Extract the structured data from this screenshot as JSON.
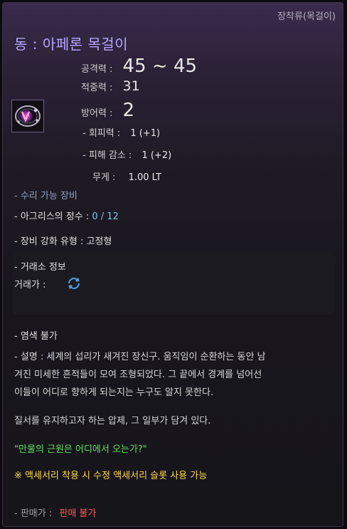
{
  "item": {
    "category": "장착류(목걸이)",
    "name": "동 : 아페론 목걸이",
    "icon": "necklace-icon"
  },
  "stats": {
    "attack_label": "공격력 :",
    "attack_value": "45 ~ 45",
    "accuracy_label": "적중력 :",
    "accuracy_value": "31",
    "defense_label": "방어력 :",
    "defense_value": "2",
    "evasion_label": "- 회피력 :",
    "evasion_value": "1 (+1)",
    "dmg_reduction_label": "- 피해 감소 :",
    "dmg_reduction_value": "1 (+2)",
    "weight_label": "무게 :",
    "weight_value": "1.00 LT"
  },
  "info": {
    "repairable": "- 수리 가능 장비",
    "agris_label": "- 아그리스의 정수 :",
    "agris_value": "0 / 12",
    "enhance_type": "- 장비 강화 유형 : 고정형"
  },
  "market": {
    "header": "- 거래소 정보",
    "price_label": "거래가 :",
    "loading_icon": "refresh-icon"
  },
  "dye": "- 염색 불가",
  "description": {
    "line1": "- 설명 : 세계의 섭리가 새겨진 장신구. 움직임이 순환하는 동안 남",
    "line2": "겨진 미세한 흔적들이 모여 조형되었다. 그 끝에서 경계를 넘어선",
    "line3": "이들이 어디로 향하게 되는지는 누구도 알지 못한다.",
    "line4": "질서를 유지하고자 하는 압제, 그 일부가 담겨 있다.",
    "quote": "\"만물의 근원은 어디에서 오는가?\"",
    "note": "※ 액세서리 착용 시 수정 액세서리 슬롯 사용 가능"
  },
  "sell": {
    "label": "- 판매가 :",
    "value": "판매 불가"
  },
  "colors": {
    "title": "#b8a6ff",
    "quote": "#5fe05f",
    "note": "#ffd84a",
    "unsellable": "#ff5a5a",
    "agris": "#7fc6e8"
  }
}
